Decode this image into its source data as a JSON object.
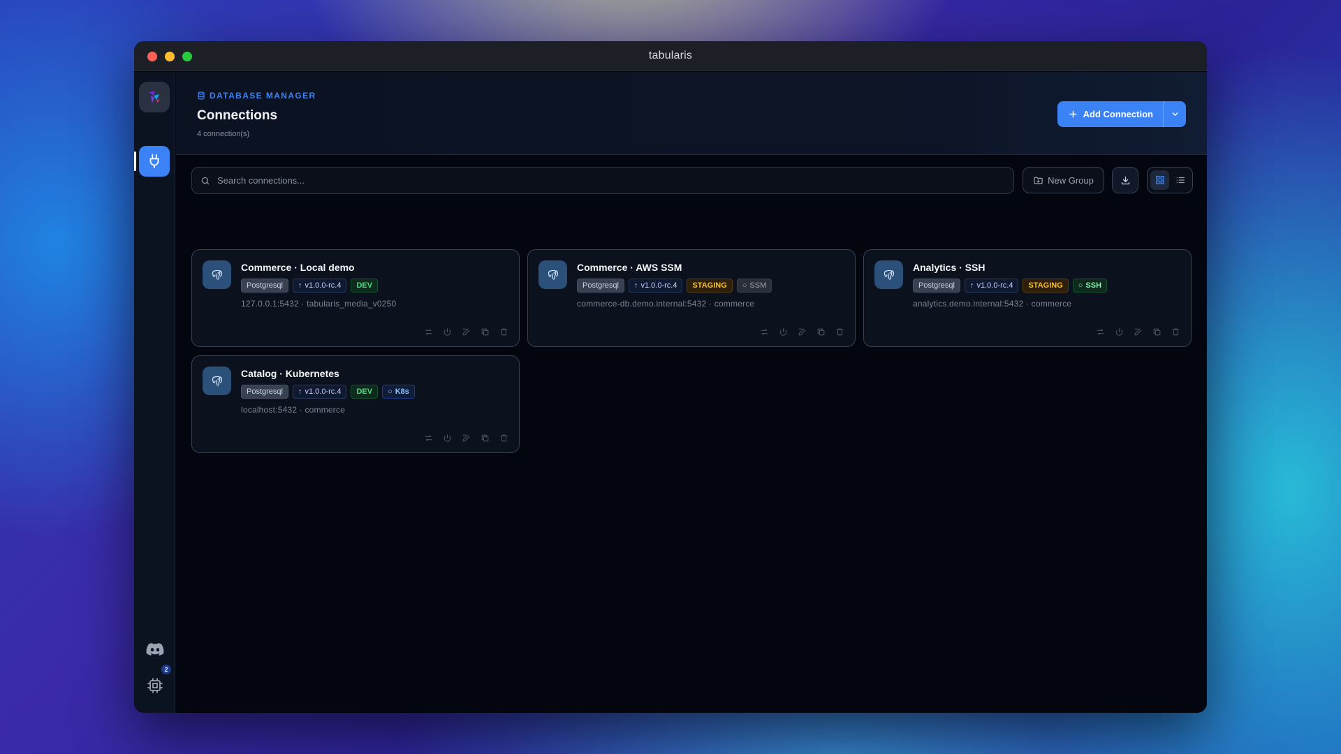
{
  "window": {
    "title": "tabularis"
  },
  "sidebar": {
    "settings_badge": "2"
  },
  "header": {
    "eyebrow": "DATABASE MANAGER",
    "title": "Connections",
    "subtitle": "4 connection(s)",
    "add_button": "Add Connection"
  },
  "toolbar": {
    "search_placeholder": "Search connections...",
    "new_group": "New Group"
  },
  "connections": [
    {
      "name": "Commerce · Local demo",
      "engine": "Postgresql",
      "version": "v1.0.0-rc.4",
      "env": "DEV",
      "tunnel": "",
      "host": "127.0.0.1:5432 · tabularis_media_v0250"
    },
    {
      "name": "Commerce · AWS SSM",
      "engine": "Postgresql",
      "version": "v1.0.0-rc.4",
      "env": "STAGING",
      "tunnel": "SSM",
      "host": "commerce-db.demo.internal:5432 · commerce"
    },
    {
      "name": "Analytics · SSH",
      "engine": "Postgresql",
      "version": "v1.0.0-rc.4",
      "env": "STAGING",
      "tunnel": "SSH",
      "host": "analytics.demo.internal:5432 · commerce"
    },
    {
      "name": "Catalog · Kubernetes",
      "engine": "Postgresql",
      "version": "v1.0.0-rc.4",
      "env": "DEV",
      "tunnel": "K8s",
      "host": "localhost:5432 · commerce"
    }
  ],
  "colors": {
    "accent": "#3b82f6",
    "dev": "#4ade80",
    "staging": "#fbbf24"
  }
}
